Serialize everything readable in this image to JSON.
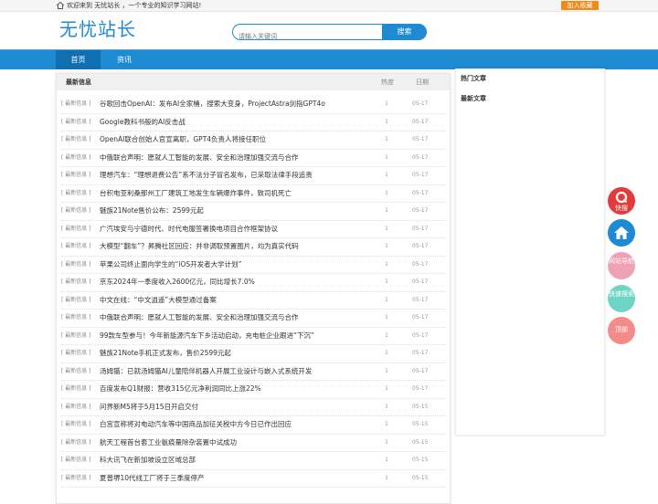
{
  "topbar": {
    "welcome": "欢迎来到 无忧站长 ，一个专业的知识学习网站!",
    "favorite_label": "加入收藏"
  },
  "header": {
    "logo": "无忧站长",
    "search_placeholder": "请输入关键词",
    "search_button": "搜索"
  },
  "nav": {
    "tabs": [
      {
        "label": "首页"
      },
      {
        "label": "资讯"
      }
    ]
  },
  "main": {
    "heading": "最新信息",
    "col_hot": "热度",
    "col_date": "日期",
    "rows": [
      {
        "tag": "[ 最新信息 ]",
        "title": "谷歌回击OpenAI：发布AI全家桶，搜索大变身，ProjectAstra剑指GPT4o",
        "hot": "1",
        "date": "05-17"
      },
      {
        "tag": "[ 最新信息 ]",
        "title": "Google教科书般的AI反击战",
        "hot": "1",
        "date": "05-17"
      },
      {
        "tag": "[ 最新信息 ]",
        "title": "OpenAI联合创始人官宣离职，GPT4负责人将接任职位",
        "hot": "1",
        "date": "05-17"
      },
      {
        "tag": "[ 最新信息 ]",
        "title": "中俄联合声明：愿就人工智能的发展、安全和治理加强交流与合作",
        "hot": "1",
        "date": "05-17"
      },
      {
        "tag": "[ 最新信息 ]",
        "title": "理想汽车：“理想退费公告”系不法分子冒名发布，已采取法律手段追责",
        "hot": "1",
        "date": "05-17"
      },
      {
        "tag": "[ 最新信息 ]",
        "title": "台积电亚利桑那州工厂建筑工地发生车辆爆炸事件，致司机死亡",
        "hot": "1",
        "date": "05-17"
      },
      {
        "tag": "[ 最新信息 ]",
        "title": "魅族21Note售价公布：2599元起",
        "hot": "1",
        "date": "05-17"
      },
      {
        "tag": "[ 最新信息 ]",
        "title": "广汽埃安与宁德时代、时代电服签署换电项目合作框架协议",
        "hot": "1",
        "date": "05-17"
      },
      {
        "tag": "[ 最新信息 ]",
        "title": "大模型“翻车”？昇腾社区回应：并非调取预置图片，均为真实代码",
        "hot": "1",
        "date": "05-17"
      },
      {
        "tag": "[ 最新信息 ]",
        "title": "苹果公司终止面向学生的“iOS开发者大学计划”",
        "hot": "1",
        "date": "05-17"
      },
      {
        "tag": "[ 最新信息 ]",
        "title": "京东2024年一季度收入2600亿元，同比增长7.0%",
        "hot": "1",
        "date": "05-17"
      },
      {
        "tag": "[ 最新信息 ]",
        "title": "中文在线：“中文逍遥”大模型通过备案",
        "hot": "1",
        "date": "05-17"
      },
      {
        "tag": "[ 最新信息 ]",
        "title": "中俄联合声明：愿就人工智能的发展、安全和治理加强交流与合作",
        "hot": "1",
        "date": "05-17"
      },
      {
        "tag": "[ 最新信息 ]",
        "title": "99款车型参与！今年新能源汽车下乡活动启动，充电桩企业跟进“下沉”",
        "hot": "1",
        "date": "05-17"
      },
      {
        "tag": "[ 最新信息 ]",
        "title": "魅族21Note手机正式发布，售价2599元起",
        "hot": "1",
        "date": "05-17"
      },
      {
        "tag": "[ 最新信息 ]",
        "title": "汤姆猫：已就汤姆猫AI儿童陪伴机器人开展工业设计与嵌入式系统开发",
        "hot": "1",
        "date": "05-17"
      },
      {
        "tag": "[ 最新信息 ]",
        "title": "百度发布Q1财报：营收315亿元净利润同比上涨22%",
        "hot": "1",
        "date": "05-17"
      },
      {
        "tag": "[ 最新信息 ]",
        "title": "问界新M5将于5月15日开启交付",
        "hot": "1",
        "date": "05-15"
      },
      {
        "tag": "[ 最新信息 ]",
        "title": "白宫宣称将对电动汽车等中国商品加征关税中方今日已作出回应",
        "hot": "1",
        "date": "05-15"
      },
      {
        "tag": "[ 最新信息 ]",
        "title": "航天工程首台套工业氨痕量除杂装置中试成功",
        "hot": "1",
        "date": "05-15"
      },
      {
        "tag": "[ 最新信息 ]",
        "title": "科大讯飞在新加坡设立区域总部",
        "hot": "1",
        "date": "05-15"
      },
      {
        "tag": "[ 最新信息 ]",
        "title": "夏普堺10代线工厂将于三季度停产",
        "hot": "1",
        "date": "05-15"
      }
    ]
  },
  "sidebar": {
    "hot_articles": "热门文章",
    "latest_info": "最新文章"
  },
  "float_buttons": [
    {
      "label": "快搜",
      "color": "#e23b3b"
    },
    {
      "label": "",
      "color": "#1d8ad2"
    },
    {
      "label": "网站导航",
      "color": "#f0a1b3"
    },
    {
      "label": "快速搜索",
      "color": "#6fd6c7"
    },
    {
      "label": "顶部",
      "color": "#f58a8a"
    }
  ]
}
